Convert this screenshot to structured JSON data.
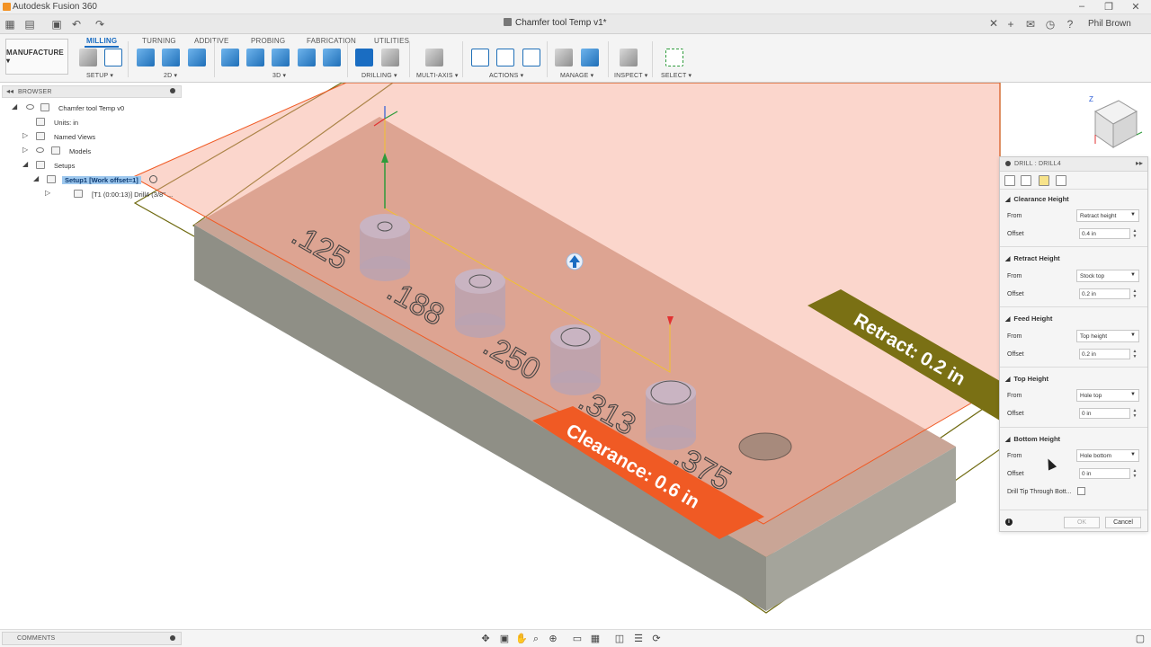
{
  "app": {
    "title": "Autodesk Fusion 360",
    "document_title": "Chamfer tool Temp v1*",
    "user": "Phil Brown"
  },
  "ribbon": {
    "workspace": "MANUFACTURE ▾",
    "tabs": [
      "MILLING",
      "TURNING",
      "ADDITIVE",
      "PROBING",
      "FABRICATION",
      "UTILITIES"
    ],
    "active_tab": "MILLING",
    "groups": [
      "SETUP ▾",
      "2D ▾",
      "3D ▾",
      "DRILLING ▾",
      "MULTI-AXIS ▾",
      "ACTIONS ▾",
      "MANAGE ▾",
      "INSPECT ▾",
      "SELECT ▾"
    ]
  },
  "browser": {
    "title": "BROWSER",
    "items": [
      {
        "label": "Chamfer tool Temp v0"
      },
      {
        "label": "Units: in"
      },
      {
        "label": "Named Views"
      },
      {
        "label": "Models"
      },
      {
        "label": "Setups"
      },
      {
        "label": "Setup1 [Work offset=1]"
      },
      {
        "label": "[T1 (0:00:13)] Drill4 (3/8\" ..."
      }
    ]
  },
  "scene": {
    "hole_labels": [
      ".125",
      ".188",
      ".250",
      ".313",
      ".375"
    ],
    "clearance_label": "Clearance: 0.6 in",
    "retract_label": "Retract: 0.2 in",
    "colors": {
      "clearance_plane": "#f7a58f",
      "clearance_tag": "#f05a24",
      "retract_tag": "#7a7014",
      "stock_top": "#c9a596",
      "stock_side": "#8f8f86"
    }
  },
  "panel": {
    "title": "DRILL : DRILL4",
    "sections": {
      "clearance": {
        "title": "Clearance Height",
        "from_label": "From",
        "from_value": "Retract height",
        "offset_label": "Offset",
        "offset_value": "0.4 in"
      },
      "retract": {
        "title": "Retract Height",
        "from_label": "From",
        "from_value": "Stock top",
        "offset_label": "Offset",
        "offset_value": "0.2 in"
      },
      "feed": {
        "title": "Feed Height",
        "from_label": "From",
        "from_value": "Top height",
        "offset_label": "Offset",
        "offset_value": "0.2 in"
      },
      "top": {
        "title": "Top Height",
        "from_label": "From",
        "from_value": "Hole top",
        "offset_label": "Offset",
        "offset_value": "0 in"
      },
      "bottom": {
        "title": "Bottom Height",
        "from_label": "From",
        "from_value": "Hole bottom",
        "offset_label": "Offset",
        "offset_value": "0 in"
      }
    },
    "drill_tip_label": "Drill Tip Through Bott...",
    "ok_label": "OK",
    "cancel_label": "Cancel"
  },
  "bottom": {
    "comments_title": "COMMENTS"
  }
}
